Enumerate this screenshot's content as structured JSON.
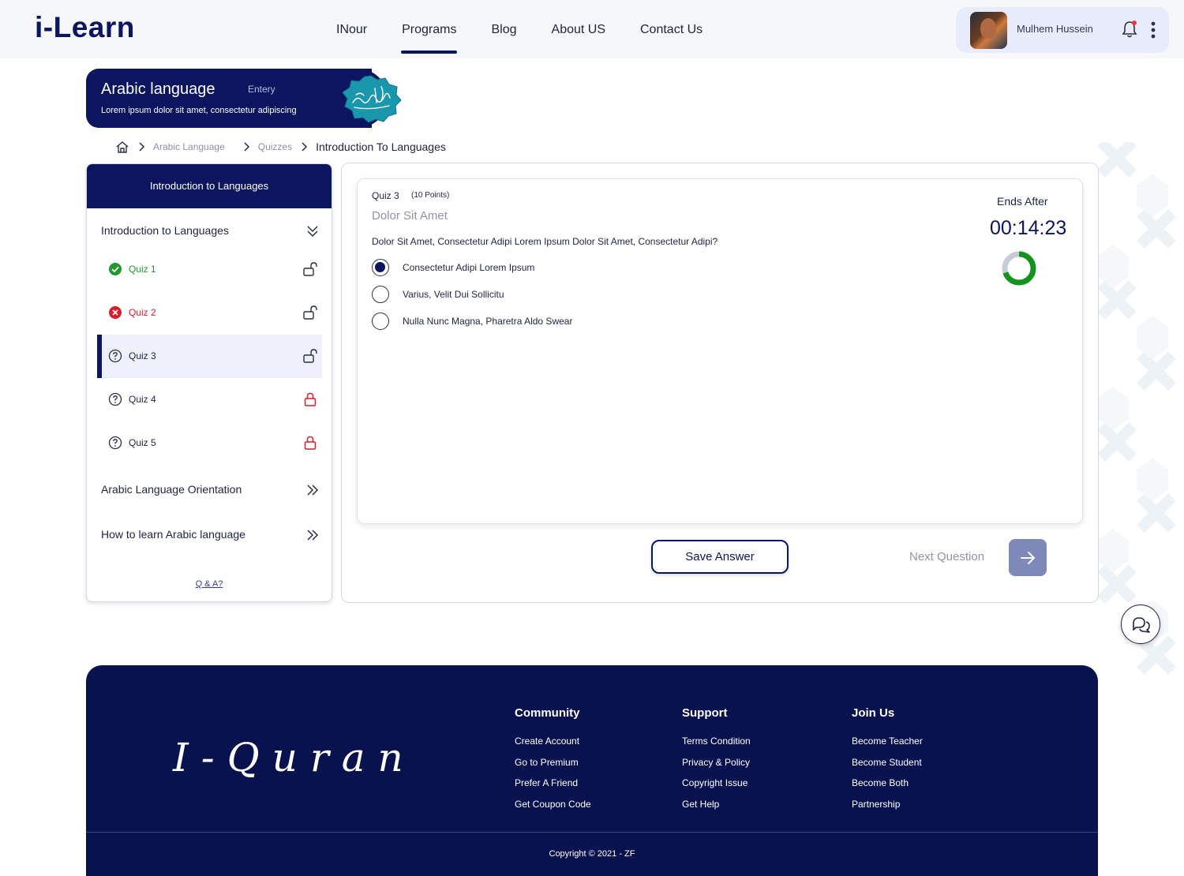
{
  "brand": {
    "logo": "i-Learn"
  },
  "nav": {
    "items": [
      {
        "label": "INour"
      },
      {
        "label": "Programs",
        "active": true
      },
      {
        "label": "Blog"
      },
      {
        "label": "About US"
      },
      {
        "label": "Contact Us"
      }
    ]
  },
  "user": {
    "name": "Mulhem Hussein"
  },
  "course": {
    "title": "Arabic language",
    "level": "Entery",
    "description": "Lorem ipsum dolor sit amet, consectetur adipiscing"
  },
  "breadcrumb": {
    "items": [
      "Arabic Language",
      "Quizzes"
    ],
    "current": "Introduction To Languages"
  },
  "sidebar": {
    "header": "Introduction to Languages",
    "sections": [
      {
        "label": "Introduction to Languages",
        "expanded": true
      },
      {
        "label": "Arabic Language Orientation",
        "expanded": false
      },
      {
        "label": "How to learn Arabic language",
        "expanded": false
      }
    ],
    "quizzes": [
      {
        "label": "Quiz 1",
        "status": "passed",
        "lock": "unlocked"
      },
      {
        "label": "Quiz 2",
        "status": "failed",
        "lock": "unlocked"
      },
      {
        "label": "Quiz 3",
        "status": "current",
        "lock": "unlocked"
      },
      {
        "label": "Quiz 4",
        "status": "pending",
        "lock": "locked"
      },
      {
        "label": "Quiz 5",
        "status": "pending",
        "lock": "locked"
      }
    ],
    "qa_link": "Q & A?"
  },
  "quiz": {
    "number": "Quiz 3",
    "points": "(10 Points)",
    "subtitle": "Dolor Sit Amet",
    "question": "Dolor Sit Amet, Consectetur Adipi Lorem Ipsum Dolor Sit Amet, Consectetur Adipi?",
    "options": [
      {
        "label": "Consectetur Adipi Lorem Ipsum",
        "selected": true
      },
      {
        "label": "Varius, Velit Dui Sollicitu",
        "selected": false
      },
      {
        "label": "Nulla Nunc Magna, Pharetra Aldo Swear",
        "selected": false
      }
    ],
    "timer": {
      "label": "Ends After",
      "value": "00:14:23",
      "remaining_fraction": 0.7
    },
    "save_label": "Save Answer",
    "next_label": "Next Question"
  },
  "footer": {
    "logo": "I-Quran",
    "columns": [
      {
        "title": "Community",
        "links": [
          "Create Account",
          "Go to Premium",
          "Prefer A Friend",
          "Get Coupon Code"
        ]
      },
      {
        "title": "Support",
        "links": [
          "Terms  Condition",
          "Privacy & Policy",
          "Copyright Issue",
          "Get Help"
        ]
      },
      {
        "title": "Join Us",
        "links": [
          "Become Teacher",
          "Become Student",
          "Become Both",
          "Partnership"
        ]
      }
    ],
    "copyright": "Copyright ©  2021  - ZF"
  },
  "colors": {
    "primary": "#0b1560",
    "success": "#1e9a2e",
    "danger": "#d61f2b",
    "accent_bg": "#e7ebfb",
    "next_button": "#7e89b8"
  }
}
